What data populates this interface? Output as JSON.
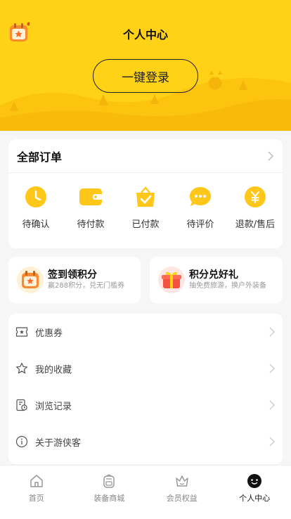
{
  "header": {
    "title": "个人中心",
    "login_label": "一键登录",
    "accent_color": "#ffd117"
  },
  "orders": {
    "title": "全部订单",
    "items": [
      {
        "label": "待确认",
        "icon": "clock-icon"
      },
      {
        "label": "待付款",
        "icon": "wallet-icon"
      },
      {
        "label": "已付款",
        "icon": "paid-bag-icon"
      },
      {
        "label": "待评价",
        "icon": "comment-icon"
      },
      {
        "label": "退款/售后",
        "icon": "refund-icon"
      }
    ]
  },
  "promos": [
    {
      "title": "签到领积分",
      "subtitle": "赢288积分，兑无门槛券",
      "icon": "calendar-icon"
    },
    {
      "title": "积分兑好礼",
      "subtitle": "抽免费旅游，换户外装备",
      "icon": "gift-icon"
    }
  ],
  "menu": [
    {
      "label": "优惠券",
      "icon": "coupon-icon"
    },
    {
      "label": "我的收藏",
      "icon": "star-icon"
    },
    {
      "label": "浏览记录",
      "icon": "history-icon"
    },
    {
      "label": "关于游侠客",
      "icon": "info-icon"
    }
  ],
  "tabbar": [
    {
      "label": "首页",
      "icon": "home-icon",
      "active": false
    },
    {
      "label": "装备商城",
      "icon": "backpack-icon",
      "active": false
    },
    {
      "label": "会员权益",
      "icon": "crown-icon",
      "active": false
    },
    {
      "label": "个人中心",
      "icon": "profile-icon",
      "active": true
    }
  ]
}
